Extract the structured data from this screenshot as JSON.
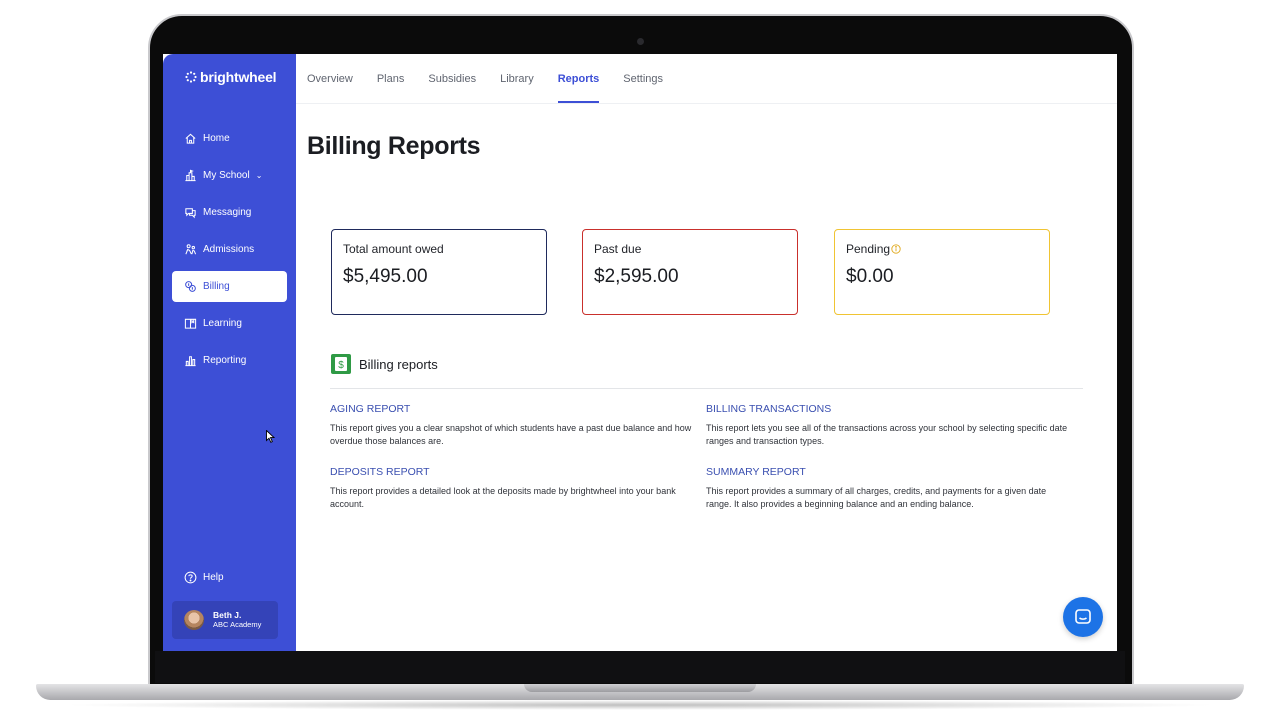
{
  "app": {
    "logo_text": "brightwheel"
  },
  "tabs": [
    {
      "label": "Overview"
    },
    {
      "label": "Plans"
    },
    {
      "label": "Subsidies"
    },
    {
      "label": "Library"
    },
    {
      "label": "Reports",
      "active": true
    },
    {
      "label": "Settings"
    }
  ],
  "sidebar": {
    "items": [
      {
        "label": "Home",
        "icon": "home-icon"
      },
      {
        "label": "My School",
        "icon": "school-icon",
        "expandable": true
      },
      {
        "label": "Messaging",
        "icon": "messaging-icon"
      },
      {
        "label": "Admissions",
        "icon": "admissions-icon"
      },
      {
        "label": "Billing",
        "icon": "billing-icon",
        "active": true
      },
      {
        "label": "Learning",
        "icon": "learning-icon"
      },
      {
        "label": "Reporting",
        "icon": "reporting-icon"
      }
    ],
    "help_label": "Help",
    "user": {
      "name": "Beth J.",
      "org": "ABC Academy"
    }
  },
  "page": {
    "title": "Billing Reports"
  },
  "cards": [
    {
      "label": "Total amount owed",
      "value": "$5,495.00",
      "border_color": "#1f2a5c"
    },
    {
      "label": "Past due",
      "value": "$2,595.00",
      "border_color": "#c9302c"
    },
    {
      "label": "Pending",
      "value": "$0.00",
      "border_color": "#f0c433"
    }
  ],
  "section": {
    "title": "Billing reports"
  },
  "reports": [
    {
      "title": "AGING REPORT",
      "description": "This report gives you a clear snapshot of which students have a past due balance and how overdue those balances are."
    },
    {
      "title": "BILLING TRANSACTIONS",
      "description": "This report lets you see all of the transactions across your school by selecting specific date ranges and transaction types."
    },
    {
      "title": "DEPOSITS REPORT",
      "description": "This report provides a detailed look at the deposits made by brightwheel into your bank account."
    },
    {
      "title": "SUMMARY REPORT",
      "description": "This report provides a summary of all charges, credits, and payments for a given date range. It also provides a beginning balance and an ending balance."
    }
  ],
  "colors": {
    "brand": "#3d4fd6",
    "link": "#3a4fb0",
    "chat": "#1d73e6"
  }
}
